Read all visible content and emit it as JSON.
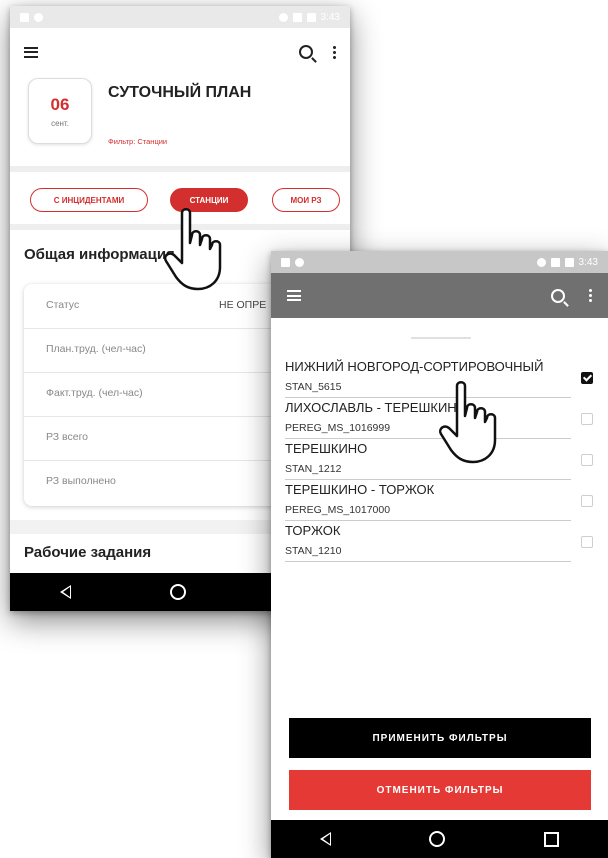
{
  "phone_left": {
    "status_time": "3:43",
    "date_day": "06",
    "date_month": "сент.",
    "title": "СУТОЧНЫЙ ПЛАН",
    "filter_label": "Фильтр: Станции",
    "chips": [
      "С ИНЦИДЕНТАМИ",
      "СТАНЦИИ",
      "МОИ РЗ"
    ],
    "active_chip": "СТАНЦИИ",
    "general_info_title": "Общая информация",
    "info_rows": [
      {
        "label": "Статус",
        "value": "НЕ ОПРЕ"
      },
      {
        "label": "План.труд. (чел-час)",
        "value": ""
      },
      {
        "label": "Факт.труд. (чел-час)",
        "value": ""
      },
      {
        "label": "РЗ всего",
        "value": ""
      },
      {
        "label": "РЗ выполнено",
        "value": ""
      }
    ],
    "work_tasks_title": "Рабочие задания"
  },
  "phone_right": {
    "status_time": "3:43",
    "filter_items": [
      {
        "name": "НИЖНИЙ НОВГОРОД-СОРТИРОВОЧНЫЙ",
        "code": "STAN_5615",
        "checked": true
      },
      {
        "name": "ЛИХОСЛАВЛЬ - ТЕРЕШКИНО",
        "code": "PEREG_MS_1016999",
        "checked": false
      },
      {
        "name": "ТЕРЕШКИНО",
        "code": "STAN_1212",
        "checked": false
      },
      {
        "name": "ТЕРЕШКИНО - ТОРЖОК",
        "code": "PEREG_MS_1017000",
        "checked": false
      },
      {
        "name": "ТОРЖОК",
        "code": "STAN_1210",
        "checked": false
      }
    ],
    "apply_button": "ПРИМЕНИТЬ ФИЛЬТРЫ",
    "cancel_button": "ОТМЕНИТЬ ФИЛЬТРЫ"
  },
  "colors": {
    "accent": "#d32f2f",
    "cancel": "#e53935",
    "appbar_dark": "#707070"
  }
}
